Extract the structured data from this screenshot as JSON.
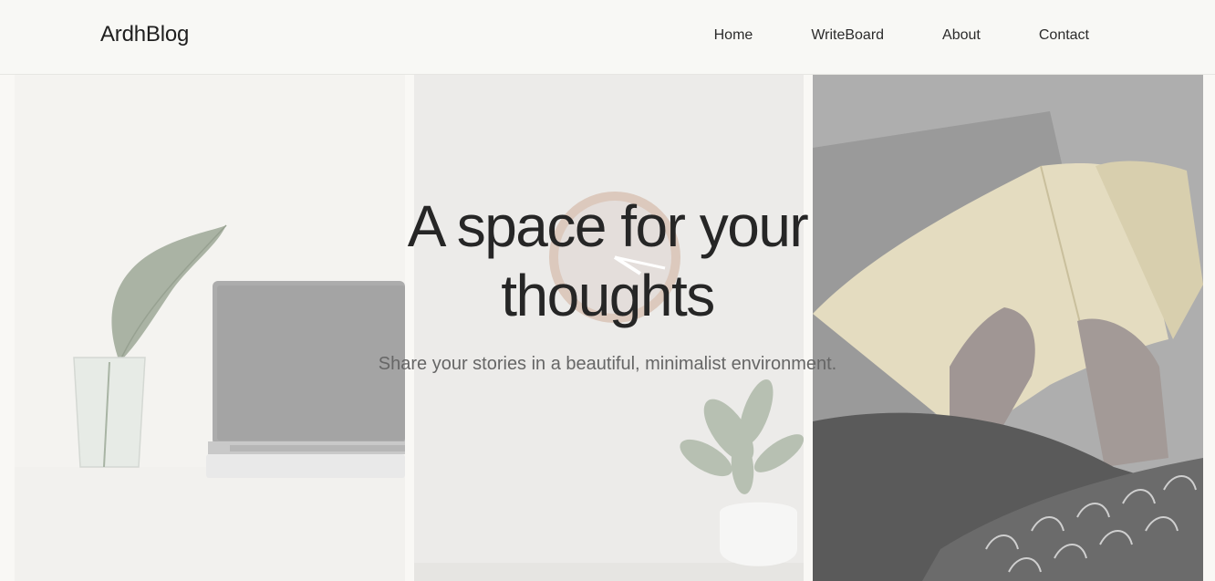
{
  "header": {
    "brand": "ArdhBlog",
    "nav": [
      "Home",
      "WriteBoard",
      "About",
      "Contact"
    ]
  },
  "hero": {
    "headline": "A space for your thoughts",
    "subtitle": "Share your stories in a beautiful, minimalist environment."
  },
  "colors": {
    "background": "#f8f8f5",
    "text": "#262626",
    "subtext": "#666666"
  }
}
